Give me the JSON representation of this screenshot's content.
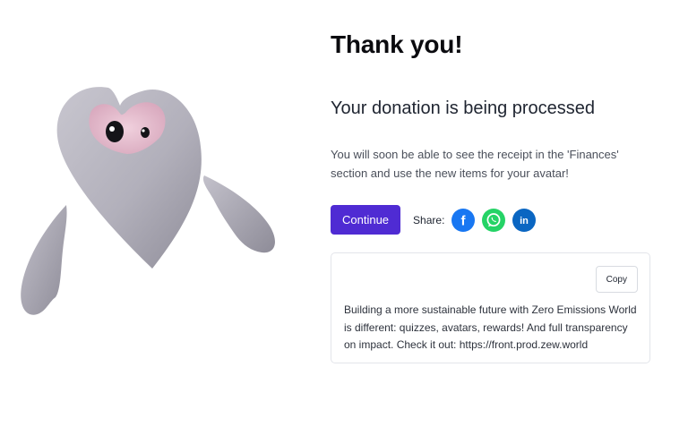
{
  "header": {
    "title": "Thank you!",
    "subtitle": "Your donation is being processed"
  },
  "main": {
    "description": "You will soon be able to see the receipt in the 'Finances' section and use the new items for your avatar!",
    "continue_label": "Continue",
    "share_label": "Share:",
    "social": [
      {
        "icon": "facebook-icon",
        "glyph": "f",
        "color": "#1877f2"
      },
      {
        "icon": "whatsapp-icon",
        "color": "#25d366"
      },
      {
        "icon": "linkedin-icon",
        "glyph": "in",
        "color": "#0a66c2"
      }
    ]
  },
  "share_box": {
    "copy_label": "Copy",
    "text": "Building a more sustainable future with Zero Emissions World is different: quizzes, avatars, rewards! And full transparency on impact. Check it out: https://front.prod.zew.world"
  },
  "colors": {
    "accent": "#4f2bd3",
    "mascot_body": "#b4b2bd",
    "mascot_face": "#e7bfd1"
  }
}
